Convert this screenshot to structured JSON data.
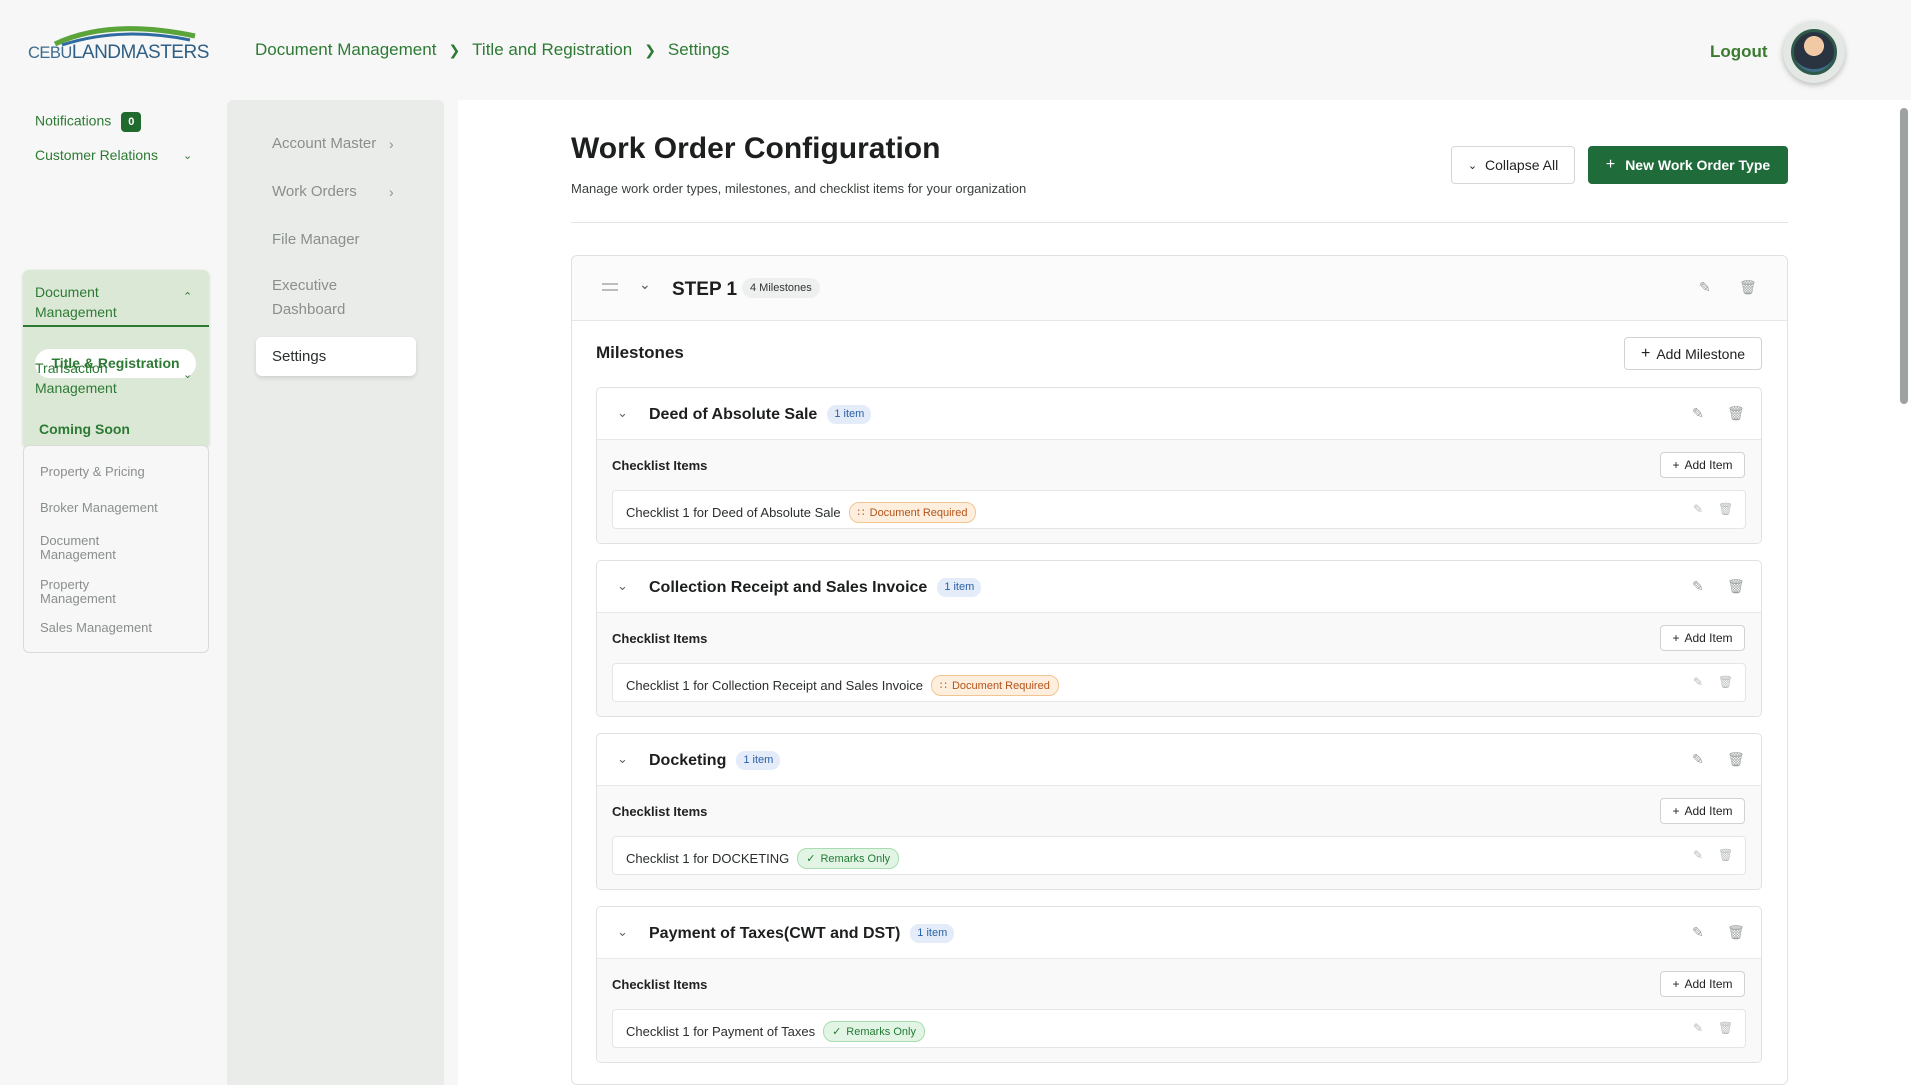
{
  "header": {
    "logo_small": "CEBU",
    "logo_big": "LANDMASTERS",
    "breadcrumb": [
      "Document Management",
      "Title and Registration",
      "Settings"
    ],
    "logout": "Logout"
  },
  "sidebar": {
    "notifications_label": "Notifications",
    "notifications_count": "0",
    "customer_relations": "Customer Relations",
    "document_management": "Document Management",
    "title_registration": "Title & Registration",
    "transaction_management": "Transaction Management",
    "coming_soon": "Coming Soon",
    "soon_items": [
      "Property & Pricing",
      "Broker Management",
      "Document Management",
      "Property Management",
      "Sales Management"
    ]
  },
  "subnav": {
    "items": [
      "Account Master",
      "Work Orders",
      "File Manager",
      "Executive Dashboard"
    ],
    "active": "Settings"
  },
  "main": {
    "title": "Work Order Configuration",
    "subtitle": "Manage work order types, milestones, and checklist items for your organization",
    "collapse_all": "Collapse All",
    "new_type": "New Work Order Type",
    "step_title": "STEP 1",
    "step_badge": "4 Milestones",
    "milestones_label": "Milestones",
    "add_milestone": "Add Milestone",
    "checklist_label": "Checklist Items",
    "add_item": "Add Item",
    "milestones": [
      {
        "name": "Deed of Absolute Sale",
        "badge": "1 item",
        "item": "Checklist 1 for Deed of Absolute Sale",
        "tag": "Document Required"
      },
      {
        "name": "Collection Receipt and Sales Invoice",
        "badge": "1 item",
        "item": "Checklist 1 for Collection Receipt and Sales Invoice",
        "tag": "Document Required"
      },
      {
        "name": "Docketing",
        "badge": "1 item",
        "item": "Checklist 1 for DOCKETING",
        "tag": "Remarks Only"
      },
      {
        "name": "Payment of Taxes(CWT and DST)",
        "badge": "1 item",
        "item": "Checklist 1 for Payment of Taxes",
        "tag": "Remarks Only"
      }
    ]
  },
  "colors": {
    "brand_green": "#1f6b3a",
    "nav_green": "#2d7a34",
    "doc_tag": "#b4541a",
    "remarks_tag": "#247a36"
  }
}
